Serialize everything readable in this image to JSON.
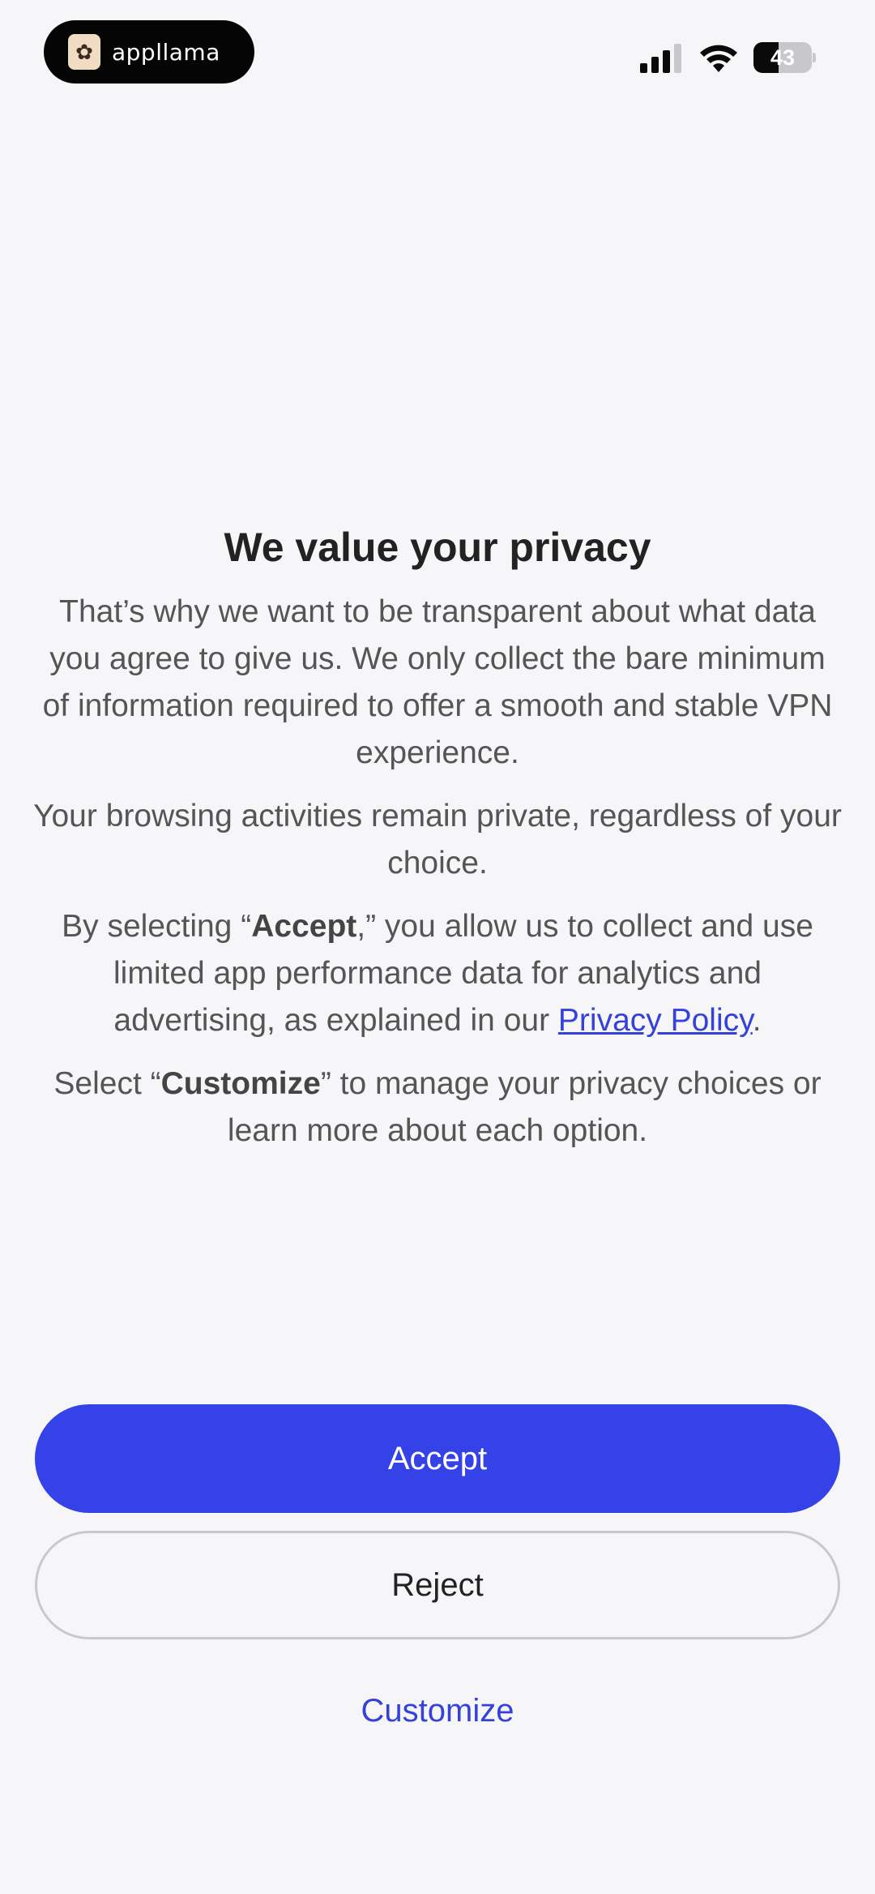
{
  "status_bar": {
    "brand_name": "appllama",
    "brand_icon": "llama-icon",
    "battery_level": "43",
    "battery_fraction": 0.43,
    "signal_icon": "cellular-signal-icon",
    "wifi_icon": "wifi-icon"
  },
  "consent": {
    "title": "We value your privacy",
    "paragraph1": "That’s why we want to be transparent about what data you agree to give us. We only collect the bare minimum of information required to offer a smooth and stable VPN experience.",
    "paragraph2": "Your browsing activities remain private, regardless of your choice.",
    "paragraph3": {
      "before": "By selecting “",
      "accept_word": "Accept",
      "after": ",” you allow us to collect and use limited app performance data for analytics and advertising, as explained in our ",
      "link": "Privacy Policy",
      "end": "."
    },
    "paragraph4": {
      "before": "Select “",
      "customize_word": "Customize",
      "after": "” to manage your privacy choices or learn more about each option."
    }
  },
  "actions": {
    "accept_label": "Accept",
    "reject_label": "Reject",
    "customize_label": "Customize"
  },
  "colors": {
    "background": "#f6f6f9",
    "accent": "#3442e8",
    "link": "#3442d9",
    "title": "#222222",
    "body_text": "#555555"
  }
}
